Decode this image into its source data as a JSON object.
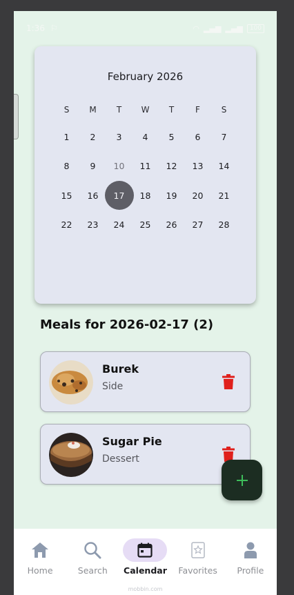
{
  "status_bar": {
    "time": "1:36",
    "battery": "100"
  },
  "calendar": {
    "title": "February 2026",
    "weekdays": [
      "S",
      "M",
      "T",
      "W",
      "T",
      "F",
      "S"
    ],
    "weeks": [
      [
        "1",
        "2",
        "3",
        "4",
        "5",
        "6",
        "7"
      ],
      [
        "8",
        "9",
        "10",
        "11",
        "12",
        "13",
        "14"
      ],
      [
        "15",
        "16",
        "17",
        "18",
        "19",
        "20",
        "21"
      ],
      [
        "22",
        "23",
        "24",
        "25",
        "26",
        "27",
        "28"
      ]
    ],
    "selected": "17",
    "muted": [
      "10"
    ]
  },
  "meals": {
    "heading": "Meals for 2026-02-17 (2)",
    "items": [
      {
        "name": "Burek",
        "category": "Side"
      },
      {
        "name": "Sugar Pie",
        "category": "Dessert"
      }
    ]
  },
  "nav": {
    "items": [
      {
        "label": "Home",
        "icon": "home-icon",
        "active": false
      },
      {
        "label": "Search",
        "icon": "search-icon",
        "active": false
      },
      {
        "label": "Calendar",
        "icon": "calendar-icon",
        "active": true
      },
      {
        "label": "Favorites",
        "icon": "favorites-icon",
        "active": false
      },
      {
        "label": "Profile",
        "icon": "profile-icon",
        "active": false
      }
    ],
    "watermark": "mobbin.com"
  },
  "colors": {
    "background": "#e4f3e9",
    "card": "#e3e6f1",
    "selected_day": "#5e5e66",
    "delete": "#e0201c",
    "fab": "#1c2d22",
    "fab_icon": "#3dbd5a",
    "nav_active": "#e6dcf5"
  }
}
